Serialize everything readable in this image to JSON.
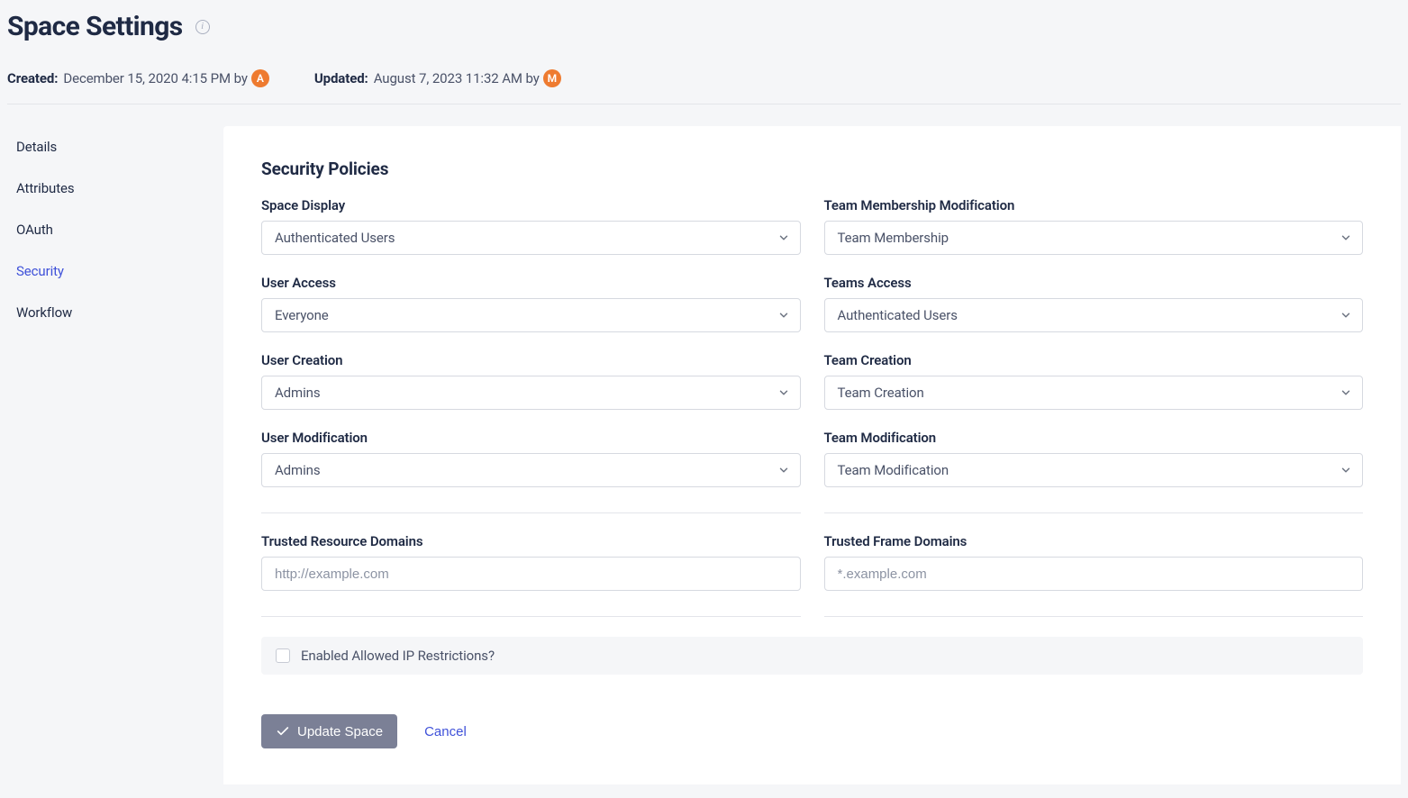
{
  "header": {
    "title": "Space Settings",
    "created_label": "Created:",
    "created_value": "December 15, 2020 4:15 PM by",
    "created_avatar": "A",
    "updated_label": "Updated:",
    "updated_value": "August 7, 2023 11:32 AM by",
    "updated_avatar": "M"
  },
  "sidebar": {
    "items": [
      {
        "label": "Details",
        "name": "sidebar-item-details",
        "active": false
      },
      {
        "label": "Attributes",
        "name": "sidebar-item-attributes",
        "active": false
      },
      {
        "label": "OAuth",
        "name": "sidebar-item-oauth",
        "active": false
      },
      {
        "label": "Security",
        "name": "sidebar-item-security",
        "active": true
      },
      {
        "label": "Workflow",
        "name": "sidebar-item-workflow",
        "active": false
      }
    ]
  },
  "section": {
    "title": "Security Policies"
  },
  "fields": {
    "space_display": {
      "label": "Space Display",
      "value": "Authenticated Users"
    },
    "team_mod_member": {
      "label": "Team Membership Modification",
      "value": "Team Membership"
    },
    "user_access": {
      "label": "User Access",
      "value": "Everyone"
    },
    "teams_access": {
      "label": "Teams Access",
      "value": "Authenticated Users"
    },
    "user_creation": {
      "label": "User Creation",
      "value": "Admins"
    },
    "team_creation": {
      "label": "Team Creation",
      "value": "Team Creation"
    },
    "user_modification": {
      "label": "User Modification",
      "value": "Admins"
    },
    "team_modification": {
      "label": "Team Modification",
      "value": "Team Modification"
    },
    "trusted_resource": {
      "label": "Trusted Resource Domains",
      "placeholder": "http://example.com"
    },
    "trusted_frame": {
      "label": "Trusted Frame Domains",
      "placeholder": "*.example.com"
    }
  },
  "ip": {
    "label": "Enabled Allowed IP Restrictions?"
  },
  "actions": {
    "update": "Update Space",
    "cancel": "Cancel"
  }
}
